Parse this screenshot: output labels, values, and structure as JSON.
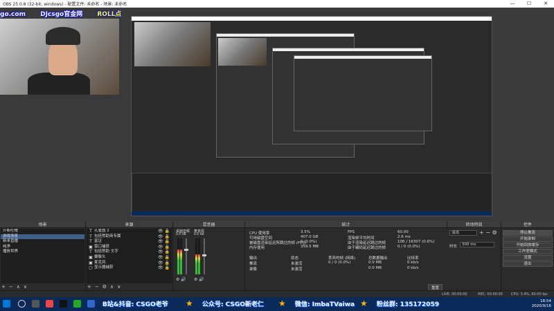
{
  "window": {
    "title": "OBS 25.0.8 (32-bit, windows) - 配置文件: 未命名 - 场景: 未命名",
    "min": "—",
    "max": "☐",
    "close": "✕"
  },
  "preview": {
    "banner_left": "go.com",
    "banner_mid": "DJcsgo官金网",
    "banner_right": "ROLL点"
  },
  "scenes": {
    "title": "场景",
    "items": [
      "开斯吐槽",
      "游戏场景",
      "新来直播",
      "纯净",
      "播放世界"
    ],
    "selected_index": 1,
    "tools": [
      "+",
      "−",
      "∧",
      "∨"
    ]
  },
  "sources": {
    "title": "来源",
    "items": [
      {
        "icon": "T",
        "label": "孔雀图 2"
      },
      {
        "icon": "T",
        "label": "包括赞助商专属"
      },
      {
        "icon": "T",
        "label": "富证"
      },
      {
        "icon": "▣",
        "label": "窗口捕获"
      },
      {
        "icon": "T",
        "label": "包括赞助 文字"
      },
      {
        "icon": "▣",
        "label": "摄像头"
      },
      {
        "icon": "▣",
        "label": "麦克风"
      },
      {
        "icon": "▢",
        "label": "显示器捕获"
      }
    ],
    "tools": [
      "+",
      "−",
      "⚙",
      "∧",
      "∨"
    ]
  },
  "mixer": {
    "title": "混音器",
    "channels": [
      {
        "name": "桌面音频",
        "db": "0.0 dB",
        "level": 0.7
      },
      {
        "name": "麦克风",
        "db": "0.0 dB",
        "level": 0.55
      }
    ]
  },
  "stats": {
    "title": "统计",
    "rows": [
      [
        "CPU 使用率",
        "3.5%",
        "FPS",
        "60.00"
      ],
      [
        "可用磁盘空间",
        "407.0 GB",
        "渲染帧平均时间",
        "2.6 ms"
      ],
      [
        "被磁盘渲染延迟所跳过的帧 (FPS)",
        "0 (0.0%)",
        "由于渲染延迟跳过的帧",
        "106 / 16307 (0.6%)"
      ],
      [
        "内存使用",
        "359.5 MB",
        "由于编码延迟跳过的帧",
        "0 / 0 (0.0%)"
      ]
    ],
    "output_header": [
      "输出",
      "状态",
      "丢弃的帧 (网络)",
      "总数据输出",
      "比特率"
    ],
    "outputs": [
      [
        "推流",
        "未激活",
        "0 / 0 (0.0%)",
        "0.0 MB",
        "0 kb/s"
      ],
      [
        "录像",
        "未激活",
        "",
        "0.0 MB",
        "0 kb/s"
      ]
    ],
    "reset": "重置"
  },
  "transitions": {
    "title": "转场特效",
    "type": "淡出",
    "duration_label": "时长",
    "duration": "300 ms"
  },
  "controls": {
    "title": "控件",
    "buttons": [
      "停止推流",
      "开始录制",
      "开始回放缓存",
      "工作室模式",
      "设置",
      "退出"
    ],
    "active_index": 0
  },
  "statusbar": {
    "live": "LIVE: 00:00:00",
    "rec": "REC: 00:00:00",
    "cpu": "CPU: 3.4%, 60.00 fps"
  },
  "taskbar": {
    "ticker1": "B站&抖音: CSGO老爷",
    "ticker2": "公众号: CSGO新老仁",
    "ticker3": "微信: ImbaTVaiwa",
    "ticker4": "粉丝群: 135172059",
    "time": "18:54",
    "date": "2020/9/16"
  }
}
